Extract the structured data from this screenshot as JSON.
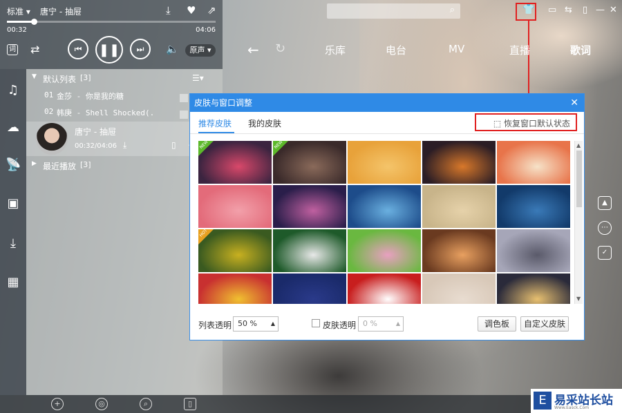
{
  "player": {
    "mode": "标准",
    "now_playing": "唐宁 - 抽屉",
    "time_current": "00:32",
    "time_total": "04:06",
    "progress": 0.13,
    "quality": "原声",
    "lyric_label": "词"
  },
  "nav": {
    "items": [
      "乐库",
      "电台",
      "MV",
      "直播",
      "歌词"
    ]
  },
  "playlist": {
    "default_header": "默认列表",
    "default_count": "[3]",
    "items": [
      {
        "index": "01",
        "title": "金莎 - 你是我的糖"
      },
      {
        "index": "02",
        "title": "韩庚 - Shell Shocked(."
      }
    ],
    "now_title": "唐宁 - 抽屉",
    "now_time": "00:32/04:06",
    "recent_header": "最近播放",
    "recent_count": "[3]"
  },
  "dialog": {
    "title": "皮肤与窗口调整",
    "tab_recommended": "推荐皮肤",
    "tab_mine": "我的皮肤",
    "restore_label": "恢复窗口默认状态",
    "list_opacity_label": "列表透明",
    "list_opacity_value": "50 %",
    "skin_opacity_label": "皮肤透明",
    "skin_opacity_value": "0 %",
    "palette_button": "调色板",
    "custom_button": "自定义皮肤",
    "badge_new": "NEW",
    "badge_hot": "HOT",
    "thumbs": [
      {
        "bg": "#3b2440",
        "accent": "#d9486a",
        "badge": "new"
      },
      {
        "bg": "#3a2a2a",
        "accent": "#8a6a5a",
        "badge": "new"
      },
      {
        "bg": "#e8a23a",
        "accent": "#f4c46a",
        "badge": ""
      },
      {
        "bg": "#2b1d25",
        "accent": "#d8782a",
        "badge": ""
      },
      {
        "bg": "#e8744a",
        "accent": "#f6e2c8",
        "badge": ""
      },
      {
        "bg": "#e36b7a",
        "accent": "#f2a0aa",
        "badge": ""
      },
      {
        "bg": "#2a1e4a",
        "accent": "#c060a0",
        "badge": ""
      },
      {
        "bg": "#1d4c8a",
        "accent": "#6ab0e0",
        "badge": ""
      },
      {
        "bg": "#c8b48a",
        "accent": "#e6d2aa",
        "badge": ""
      },
      {
        "bg": "#123a6a",
        "accent": "#3a7ab8",
        "badge": ""
      },
      {
        "bg": "#3a5a20",
        "accent": "#c8b020",
        "badge": "hot"
      },
      {
        "bg": "#1e5a2a",
        "accent": "#e8e8e8",
        "badge": ""
      },
      {
        "bg": "#6ab840",
        "accent": "#e8a0c0",
        "badge": ""
      },
      {
        "bg": "#6a3a20",
        "accent": "#e8a060",
        "badge": ""
      },
      {
        "bg": "#a6a6b8",
        "accent": "#5a5a6a",
        "badge": ""
      },
      {
        "bg": "#c83030",
        "accent": "#f0c030",
        "badge": ""
      },
      {
        "bg": "#1a2a6a",
        "accent": "#2a3a8a",
        "badge": ""
      },
      {
        "bg": "#c81e1e",
        "accent": "#ffffff",
        "badge": ""
      },
      {
        "bg": "#d8c8b8",
        "accent": "#e8dcd0",
        "badge": ""
      },
      {
        "bg": "#2a2a3a",
        "accent": "#e8c070",
        "badge": ""
      }
    ]
  },
  "watermark": {
    "logo_glyph": "E",
    "text": "易采站长站",
    "sub": "Www.Easck.Com"
  }
}
